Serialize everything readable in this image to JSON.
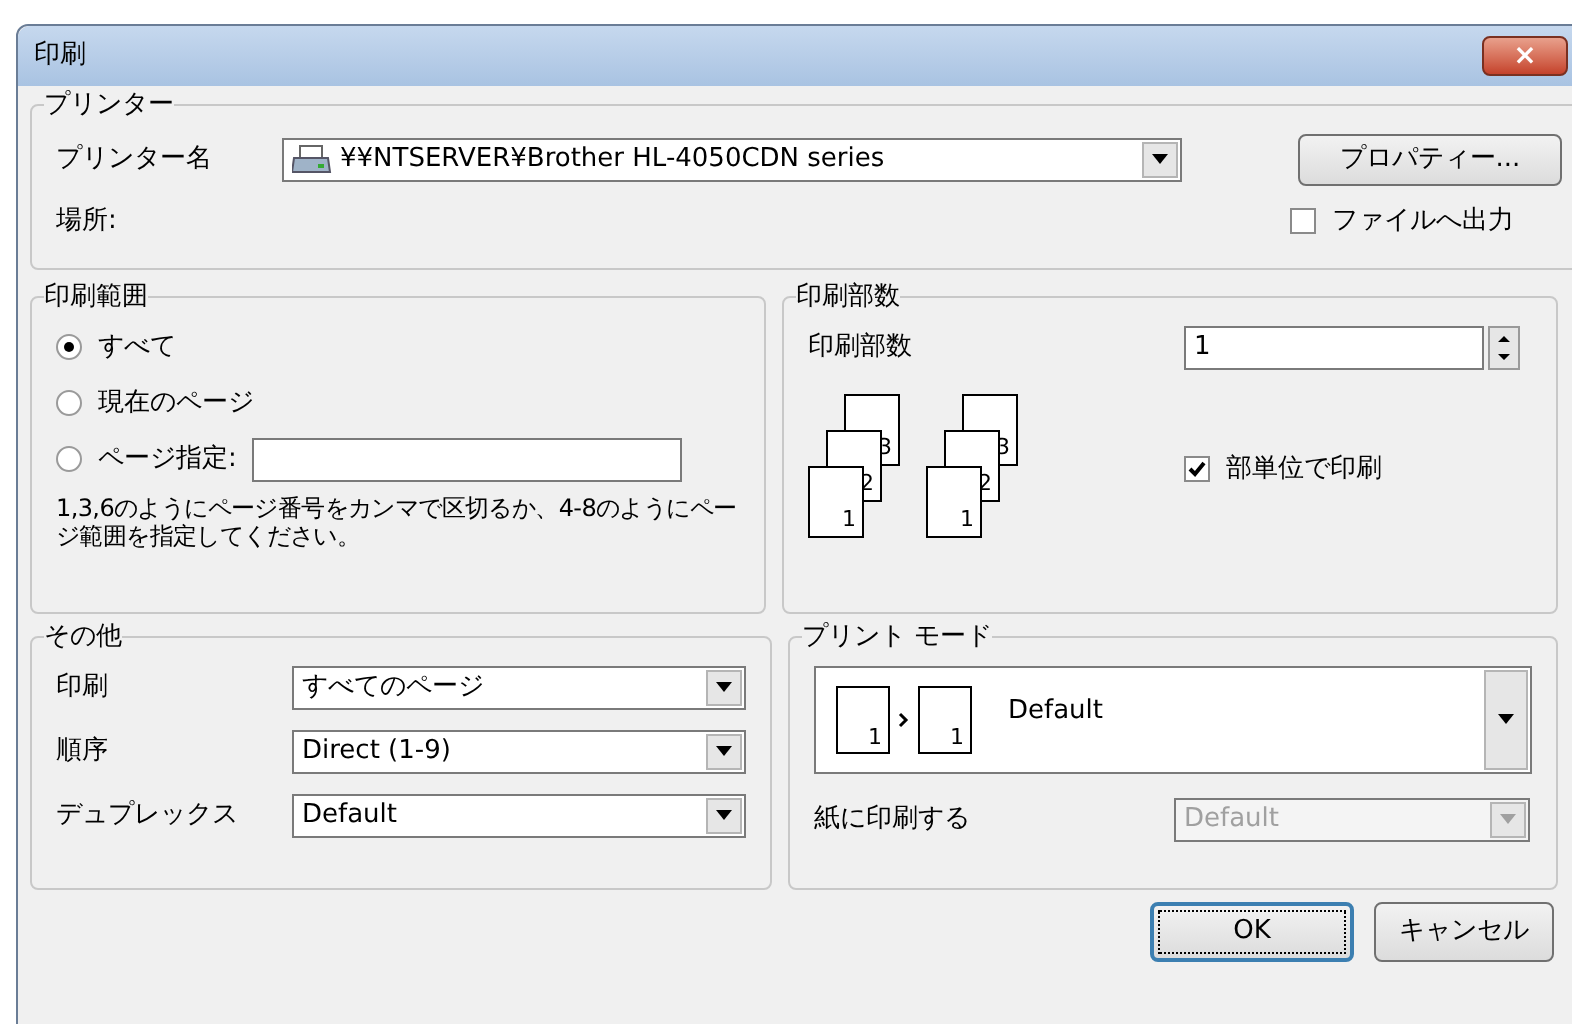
{
  "window": {
    "title": "印刷",
    "close": "×"
  },
  "printer": {
    "legend": "プリンター",
    "name_label": "プリンター名",
    "name_value": "¥¥NTSERVER¥Brother HL-4050CDN series",
    "properties_button": "プロパティー...",
    "location_label": "場所:",
    "print_to_file": {
      "label": "ファイルへ出力",
      "checked": false
    }
  },
  "range": {
    "legend": "印刷範囲",
    "options": [
      {
        "label": "すべて",
        "selected": true,
        "kind": "plain"
      },
      {
        "label": "現在のページ",
        "selected": false,
        "kind": "plain"
      },
      {
        "label": "ページ指定:",
        "selected": false,
        "kind": "field"
      }
    ],
    "hint": "1,3,6のようにページ番号をカンマで区切るか、4-8のようにページ範囲を指定してください。"
  },
  "copies": {
    "legend": "印刷部数",
    "label": "印刷部数",
    "value": "1",
    "collate_stacks": [
      [
        "1",
        "2",
        "3"
      ],
      [
        "1",
        "2",
        "3"
      ]
    ],
    "collate": {
      "label": "部単位で印刷",
      "checked": true
    }
  },
  "other": {
    "legend": "その他",
    "rows": [
      {
        "label": "印刷",
        "value": "すべてのページ"
      },
      {
        "label": "順序",
        "value": "Direct (1-9)"
      },
      {
        "label": "デュプレックス",
        "value": "Default"
      }
    ]
  },
  "print_mode": {
    "legend": "プリント モード",
    "pages": [
      "1",
      "1"
    ],
    "value": "Default",
    "paper_label": "紙に印刷する",
    "paper_value": "Default",
    "paper_disabled": true
  },
  "buttons": [
    {
      "label": "OK",
      "default": true
    },
    {
      "label": "キャンセル",
      "default": false
    }
  ]
}
